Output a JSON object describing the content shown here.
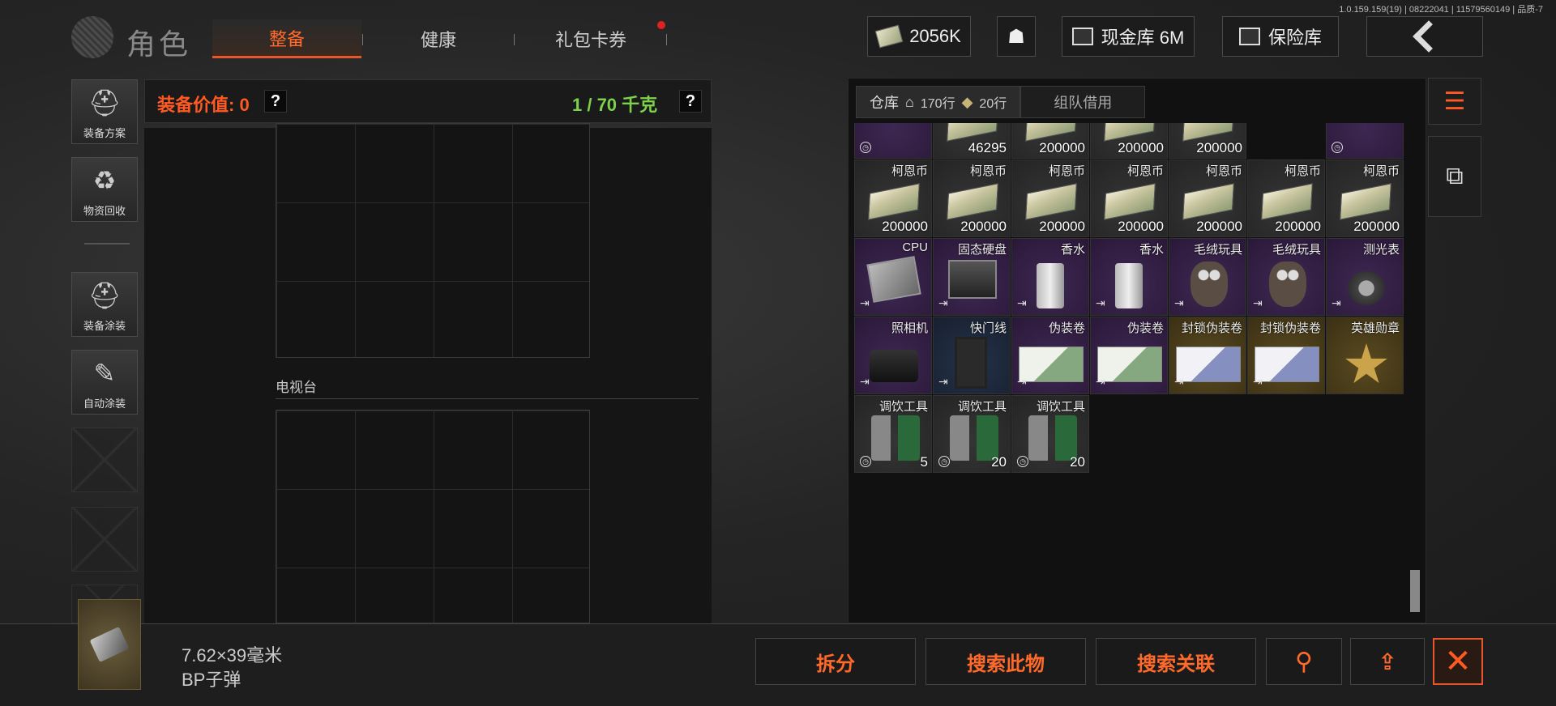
{
  "version": "1.0.159.159(19) | 08222041 | 11579560149 | 品质-7",
  "header": {
    "app_title": "角色",
    "tabs": [
      "整备",
      "健康",
      "礼包卡券"
    ],
    "currency": "2056K",
    "cash_vault": "现金库 6M",
    "safe_vault": "保险库"
  },
  "sidebar": {
    "items": [
      {
        "label": "装备方案",
        "icon": "helmet-plan-icon"
      },
      {
        "label": "物资回收",
        "icon": "recycle-icon"
      },
      {
        "label": "装备涂装",
        "icon": "helmet-paint-icon"
      },
      {
        "label": "自动涂装",
        "icon": "brush-gear-icon"
      }
    ]
  },
  "equipment": {
    "value_label": "装备价值: 0",
    "weight": "1 / 70 千克",
    "help": "?",
    "section_label": "电视台"
  },
  "inventory": {
    "tabs": {
      "warehouse": "仓库",
      "home_rows": "170行",
      "bag_rows": "20行",
      "team": "组队借用"
    },
    "rows": [
      [
        {
          "name": "",
          "count": "",
          "pic": "photo",
          "color": "purple",
          "mark": "clock"
        },
        {
          "name": "",
          "count": "46295",
          "pic": "money",
          "color": "gray"
        },
        {
          "name": "",
          "count": "200000",
          "pic": "money",
          "color": "gray"
        },
        {
          "name": "",
          "count": "200000",
          "pic": "money",
          "color": "gray"
        },
        {
          "name": "",
          "count": "200000",
          "pic": "money",
          "color": "gray"
        },
        {
          "name": "",
          "count": "",
          "pic": "",
          "color": "purple",
          "mark": "clock"
        }
      ],
      [
        {
          "name": "柯恩币",
          "count": "200000",
          "pic": "money",
          "color": "gray"
        },
        {
          "name": "柯恩币",
          "count": "200000",
          "pic": "money",
          "color": "gray"
        },
        {
          "name": "柯恩币",
          "count": "200000",
          "pic": "money",
          "color": "gray"
        },
        {
          "name": "柯恩币",
          "count": "200000",
          "pic": "money",
          "color": "gray"
        },
        {
          "name": "柯恩币",
          "count": "200000",
          "pic": "money",
          "color": "gray"
        },
        {
          "name": "柯恩币",
          "count": "200000",
          "pic": "money",
          "color": "gray"
        },
        {
          "name": "柯恩币",
          "count": "200000",
          "pic": "money",
          "color": "gray"
        }
      ],
      [
        {
          "name": "CPU",
          "count": "",
          "pic": "cpu",
          "color": "purple",
          "mark": "exit"
        },
        {
          "name": "固态硬盘",
          "count": "",
          "pic": "ssd",
          "color": "purple",
          "mark": "exit"
        },
        {
          "name": "香水",
          "count": "",
          "pic": "bottle",
          "color": "purple",
          "mark": "exit"
        },
        {
          "name": "香水",
          "count": "",
          "pic": "bottle",
          "color": "purple",
          "mark": "exit"
        },
        {
          "name": "毛绒玩具",
          "count": "",
          "pic": "owl",
          "color": "purple",
          "mark": "exit"
        },
        {
          "name": "毛绒玩具",
          "count": "",
          "pic": "owl",
          "color": "purple",
          "mark": "exit"
        },
        {
          "name": "测光表",
          "count": "",
          "pic": "meter",
          "color": "purple",
          "mark": "exit"
        }
      ],
      [
        {
          "name": "照相机",
          "count": "",
          "pic": "camera",
          "color": "purple",
          "mark": "exit"
        },
        {
          "name": "快门线",
          "count": "",
          "pic": "cable",
          "color": "blue",
          "mark": "exit"
        },
        {
          "name": "伪装卷",
          "count": "",
          "pic": "ticket",
          "color": "purple",
          "mark": "exit"
        },
        {
          "name": "伪装卷",
          "count": "",
          "pic": "ticket",
          "color": "purple",
          "mark": "exit"
        },
        {
          "name": "封锁伪装卷",
          "count": "",
          "pic": "ticket2",
          "color": "gold",
          "mark": "exit"
        },
        {
          "name": "封锁伪装卷",
          "count": "",
          "pic": "ticket2",
          "color": "gold",
          "mark": "exit"
        },
        {
          "name": "英雄勋章",
          "count": "",
          "pic": "medal",
          "color": "gold"
        }
      ],
      [
        {
          "name": "调饮工具",
          "count": "5",
          "pic": "tools",
          "color": "gray",
          "mark": "clock"
        },
        {
          "name": "调饮工具",
          "count": "20",
          "pic": "tools",
          "color": "gray",
          "mark": "clock"
        },
        {
          "name": "调饮工具",
          "count": "20",
          "pic": "tools",
          "color": "gray",
          "mark": "clock"
        }
      ]
    ]
  },
  "selected_item": {
    "line1": "7.62×39毫米",
    "line2": "BP子弹"
  },
  "actions": {
    "split": "拆分",
    "search_this": "搜索此物",
    "search_related": "搜索关联"
  }
}
